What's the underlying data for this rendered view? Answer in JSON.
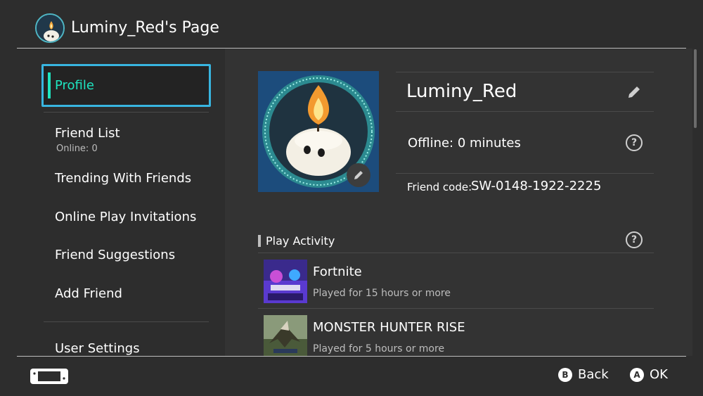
{
  "header": {
    "title": "Luminy_Red's Page",
    "avatar_icon": "candle-creature-avatar-icon"
  },
  "sidebar": {
    "items": [
      {
        "label": "Profile",
        "selected": true
      },
      {
        "label": "Friend List",
        "sublabel": "Online: 0"
      },
      {
        "label": "Trending With Friends"
      },
      {
        "label": "Online Play Invitations"
      },
      {
        "label": "Friend Suggestions"
      },
      {
        "label": "Add Friend"
      },
      {
        "label": "User Settings"
      }
    ]
  },
  "profile": {
    "username": "Luminy_Red",
    "status": "Offline: 0 minutes",
    "friend_code_label": "Friend code:",
    "friend_code": "SW-0148-1922-2225",
    "help_symbol": "?"
  },
  "play_activity": {
    "title": "Play Activity",
    "games": [
      {
        "title": "Fortnite",
        "time": "Played for 15 hours or more"
      },
      {
        "title": "MONSTER HUNTER RISE",
        "time": "Played for 5 hours or more"
      }
    ]
  },
  "footer": {
    "back_key": "B",
    "back_label": "Back",
    "ok_key": "A",
    "ok_label": "OK"
  },
  "colors": {
    "accent": "#1ee5c0",
    "selection_border": "#38b5e0",
    "background": "#2d2d2d"
  }
}
